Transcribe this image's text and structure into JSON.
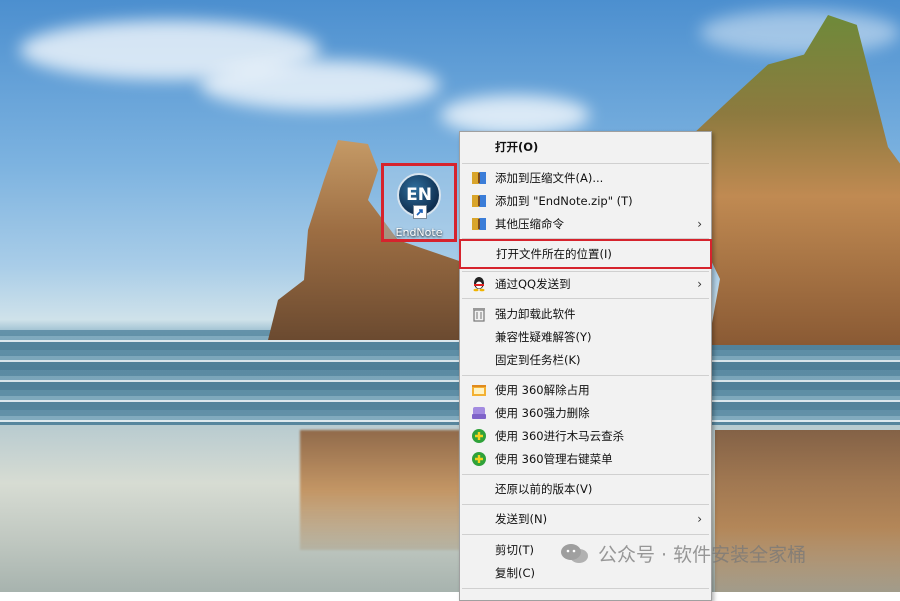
{
  "desktop": {
    "icon_label": "EndNote",
    "icon_logo_text": "EN"
  },
  "context_menu": {
    "items": [
      {
        "label": "打开(O)",
        "icon": "none",
        "bold": true
      },
      {
        "label": "添加到压缩文件(A)...",
        "icon": "archive-icon"
      },
      {
        "label": "添加到 \"EndNote.zip\" (T)",
        "icon": "archive-icon"
      },
      {
        "label": "其他压缩命令",
        "icon": "archive-icon",
        "submenu": true
      },
      {
        "label": "打开文件所在的位置(I)",
        "icon": "none",
        "highlighted": true
      },
      {
        "label": "通过QQ发送到",
        "icon": "qq-penguin-icon",
        "submenu": true
      },
      {
        "label": "强力卸载此软件",
        "icon": "trash-icon"
      },
      {
        "label": "兼容性疑难解答(Y)",
        "icon": "none"
      },
      {
        "label": "固定到任务栏(K)",
        "icon": "none"
      },
      {
        "label": "使用 360解除占用",
        "icon": "360-unlock-icon"
      },
      {
        "label": "使用 360强力删除",
        "icon": "360-shred-icon"
      },
      {
        "label": "使用 360进行木马云查杀",
        "icon": "360-scan-icon"
      },
      {
        "label": "使用 360管理右键菜单",
        "icon": "360-menu-icon"
      },
      {
        "label": "还原以前的版本(V)",
        "icon": "none"
      },
      {
        "label": "发送到(N)",
        "icon": "none",
        "submenu": true
      },
      {
        "label": "剪切(T)",
        "icon": "none"
      },
      {
        "label": "复制(C)",
        "icon": "none"
      }
    ],
    "submenu_arrow": "›"
  },
  "watermark": {
    "text": "公众号 · 软件安装全家桶"
  },
  "colors": {
    "highlight_border": "#d6232d",
    "menu_background": "#f2f2f2"
  }
}
